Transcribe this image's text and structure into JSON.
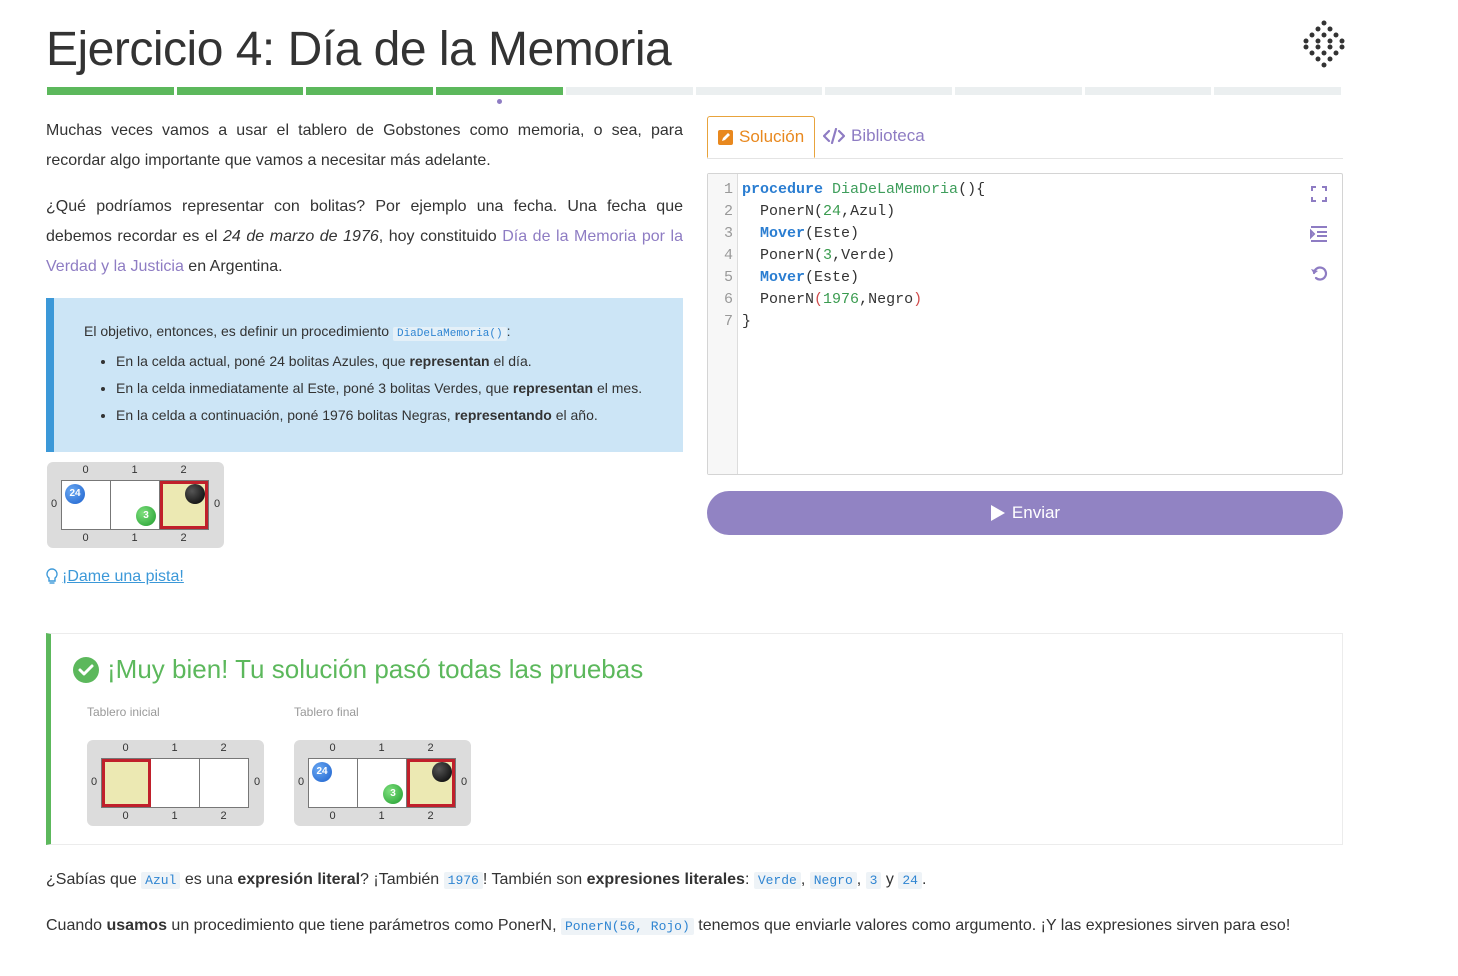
{
  "header": {
    "title": "Ejercicio 4: Día de la Memoria",
    "progress": {
      "total": 10,
      "done": 4,
      "current": 4
    }
  },
  "description": {
    "p1": "Muchas veces vamos a usar el tablero de Gobstones como memoria, o sea, para recordar algo importante que vamos a necesitar más adelante.",
    "p2_before": "¿Qué podríamos representar con bolitas? Por ejemplo una fecha. Una fecha que debemos recordar es el ",
    "p2_date": "24 de marzo de 1976",
    "p2_middle": ", hoy constituido ",
    "p2_link": "Día de la Memoria por la Verdad y la Justicia",
    "p2_after": " en Argentina."
  },
  "notice": {
    "intro_before": "El objetivo, entonces, es definir un procedimiento ",
    "intro_code": "DiaDeLaMemoria()",
    "intro_after": ":",
    "items": [
      {
        "before": "En la celda actual, poné 24 bolitas Azules, que ",
        "bold": "representan",
        "after": " el día."
      },
      {
        "before": "En la celda inmediatamente al Este, poné 3 bolitas Verdes, que ",
        "bold": "representan",
        "after": " el mes."
      },
      {
        "before": "En la celda a continuación, poné 1976 bolitas Negras, ",
        "bold": "representando",
        "after": " el año."
      }
    ]
  },
  "example_board": {
    "columns": [
      "0",
      "1",
      "2"
    ],
    "rows": [
      "0"
    ],
    "balls": {
      "azul": "24",
      "verde": "3",
      "negro": ""
    }
  },
  "hint": {
    "label": "¡Dame una pista!"
  },
  "tabs": {
    "solution": "Solución",
    "library": "Biblioteca"
  },
  "editor": {
    "line_numbers": [
      "1",
      "2",
      "3",
      "4",
      "5",
      "6",
      "7"
    ],
    "lines": [
      {
        "kw": "procedure",
        "name": "DiaDeLaMemoria",
        "rest": "(){"
      },
      {
        "fn": "PonerN",
        "open": "(",
        "num": "24",
        "rest": ",Azul)"
      },
      {
        "kw": "Mover",
        "rest": "(Este)"
      },
      {
        "fn": "PonerN",
        "open": "(",
        "num": "3",
        "rest": ",Verde)"
      },
      {
        "kw": "Mover",
        "rest": "(Este)"
      },
      {
        "fn": "PonerN",
        "open": "(",
        "num": "1976",
        "rest": ",Negro",
        "close": ")"
      },
      {
        "rest": "}"
      }
    ]
  },
  "submit": {
    "label": "Enviar"
  },
  "result": {
    "title": "¡Muy bien! Tu solución pasó todas las pruebas",
    "initial_label": "Tablero inicial",
    "final_label": "Tablero final",
    "final_balls": {
      "azul": "24",
      "verde": "3"
    }
  },
  "footer": {
    "p1": {
      "a": "¿Sabías que ",
      "code1": "Azul",
      "b": " es una ",
      "bold1": "expresión literal",
      "c": "? ¡También ",
      "code2": "1976",
      "d": "! También son ",
      "bold2": "expresiones literales",
      "e": ": ",
      "code3": "Verde",
      "f": ", ",
      "code4": "Negro",
      "g": ", ",
      "code5": "3",
      "h": " y ",
      "code6": "24",
      "i": "."
    },
    "p2": {
      "a": "Cuando ",
      "bold": "usamos",
      "b": " un procedimiento que tiene parámetros como PonerN, ",
      "code": "PonerN(56, Rojo)",
      "c": " tenemos que enviarle valores como argumento. ¡Y las expresiones sirven para eso!"
    }
  },
  "colors": {
    "accent": "#8e7cc3",
    "success": "#5cb85c",
    "tab_active": "#e8881e",
    "notice_bg": "#cce5f6",
    "highlight_cell": "#ece9b3"
  }
}
